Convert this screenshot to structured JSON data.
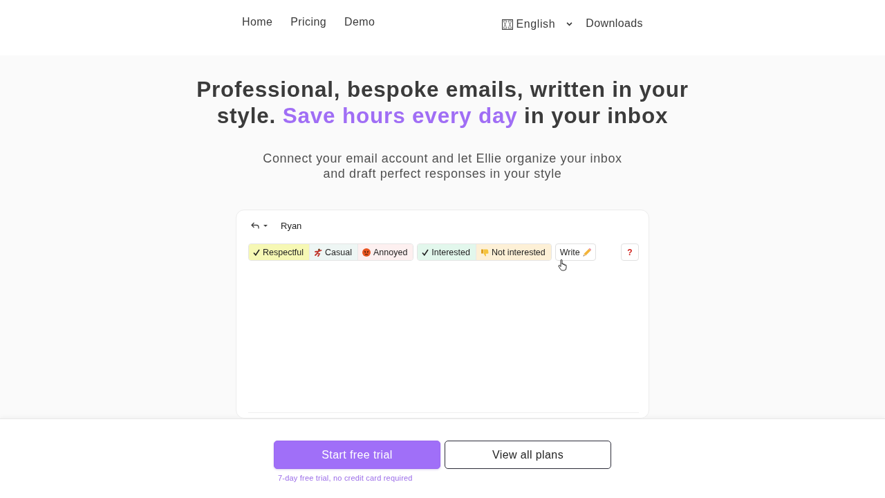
{
  "nav": {
    "links": [
      {
        "label": "Home"
      },
      {
        "label": "Pricing"
      },
      {
        "label": "Demo"
      }
    ],
    "language": {
      "label": "English"
    },
    "downloads": {
      "label": "Downloads"
    }
  },
  "hero": {
    "headline": [
      {
        "text": "Professional, bespoke emails, written in your style. ",
        "highlight": false
      },
      {
        "text": "Save hours every day",
        "highlight": true
      },
      {
        "text": " in your inbox",
        "highlight": false
      }
    ],
    "subtitle": "Connect your email account and let Ellie organize your inbox and draft perfect responses in your style"
  },
  "composer": {
    "recipient": "Ryan",
    "chip_groups": [
      [
        {
          "kind": "check",
          "label": "Respectful",
          "color": "#f6f8b4"
        },
        {
          "kind": "dancer",
          "label": "Casual",
          "color": "#eef6f4"
        },
        {
          "kind": "angry",
          "label": "Annoyed",
          "color": "#fdf0f0"
        }
      ],
      [
        {
          "kind": "check",
          "label": "Interested",
          "color": "#e2f7ec"
        },
        {
          "kind": "thumbs-down",
          "label": "Not interested",
          "color": "#fdf0d6"
        }
      ]
    ],
    "write_button": {
      "label": "Write"
    },
    "help_button": {
      "label": "?"
    }
  },
  "cta": {
    "primary": "Start free trial",
    "secondary": "View all plans",
    "note": "7-day free trial, no credit card required"
  }
}
